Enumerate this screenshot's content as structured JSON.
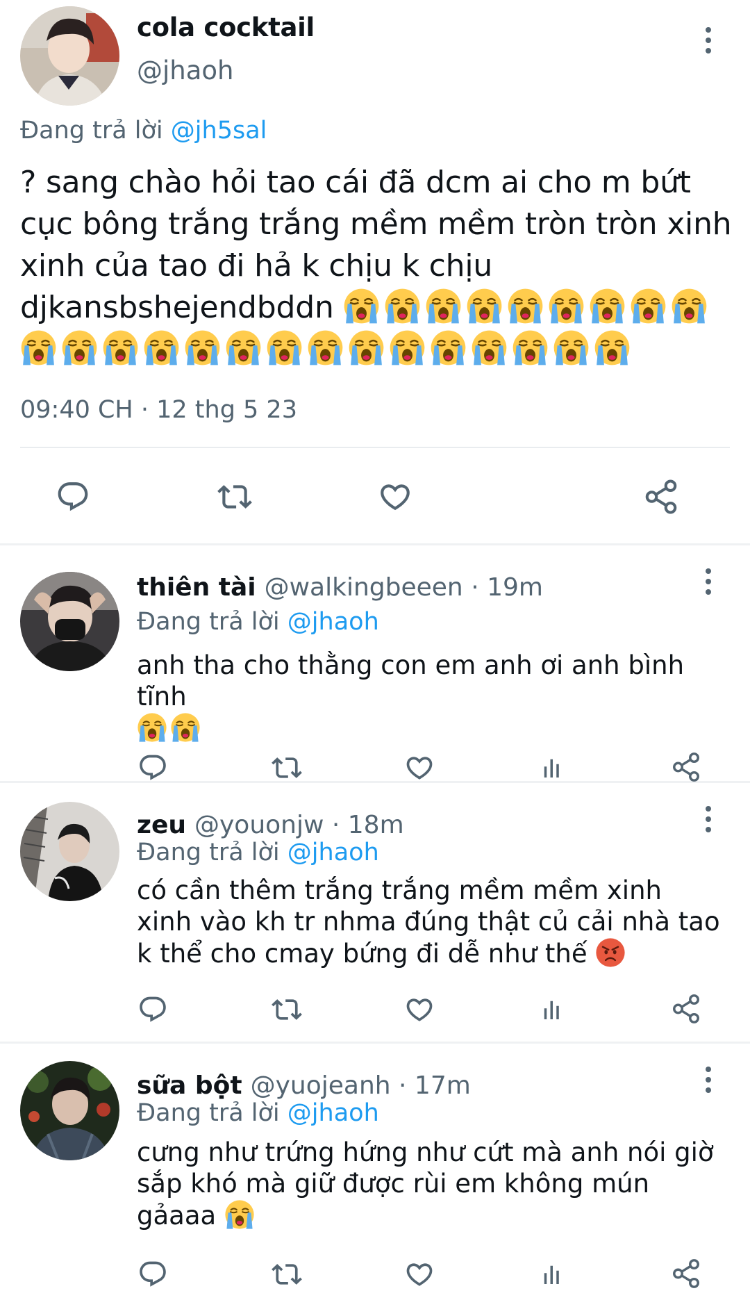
{
  "main_tweet": {
    "display_name": "cola cocktail",
    "handle": "@jhaoh",
    "replying_prefix": "Đang trả lời",
    "replying_to": "@jh5sal",
    "text": "? sang chào hỏi tao cái đã dcm ai cho m bứt cục bông trắng trắng mềm mềm tròn tròn xinh xinh của tao đi hả k chịu k chịu djkansbshejendbddn",
    "emoji_name": "loudly-crying-face",
    "emoji_count": 24,
    "timestamp": "09:40 CH · 12 thg 5 23",
    "actions": [
      "reply-icon",
      "retweet-icon",
      "like-icon",
      "share-icon"
    ]
  },
  "replies": [
    {
      "display_name": "thiên tài",
      "handle": "@walkingbeeen",
      "time": "· 19m",
      "replying_prefix": "Đang trả lời",
      "replying_to": "@jhaoh",
      "text": "anh tha cho thằng con em anh ơi anh bình tĩnh",
      "emojis": [
        "loudly-crying-face",
        "loudly-crying-face"
      ],
      "actions": [
        "reply-icon",
        "retweet-icon",
        "like-icon",
        "analytics-icon",
        "share-icon"
      ]
    },
    {
      "display_name": "zeu",
      "handle": "@youonjw",
      "time": "· 18m",
      "replying_prefix": "Đang trả lời",
      "replying_to": "@jhaoh",
      "text": "có cần thêm trắng trắng mềm mềm xinh xinh vào kh tr nhma đúng thật củ cải nhà tao k thể cho cmay bứng đi dễ như thế",
      "emojis": [
        "pouting-face"
      ],
      "actions": [
        "reply-icon",
        "retweet-icon",
        "like-icon",
        "analytics-icon",
        "share-icon"
      ]
    },
    {
      "display_name": "sữa bột",
      "handle": "@yuojeanh",
      "time": "· 17m",
      "replying_prefix": "Đang trả lời",
      "replying_to": "@jhaoh",
      "text": "cưng như trứng hứng như cứt mà anh nói giờ sắp khó mà giữ được rùi em không mún gảaaa",
      "emojis": [
        "loudly-crying-face"
      ],
      "actions": [
        "reply-icon",
        "retweet-icon",
        "like-icon",
        "analytics-icon",
        "share-icon"
      ]
    }
  ],
  "colors": {
    "text": "#0f1419",
    "secondary": "#536471",
    "mention": "#1d9bf0",
    "divider": "#eff1f3"
  }
}
